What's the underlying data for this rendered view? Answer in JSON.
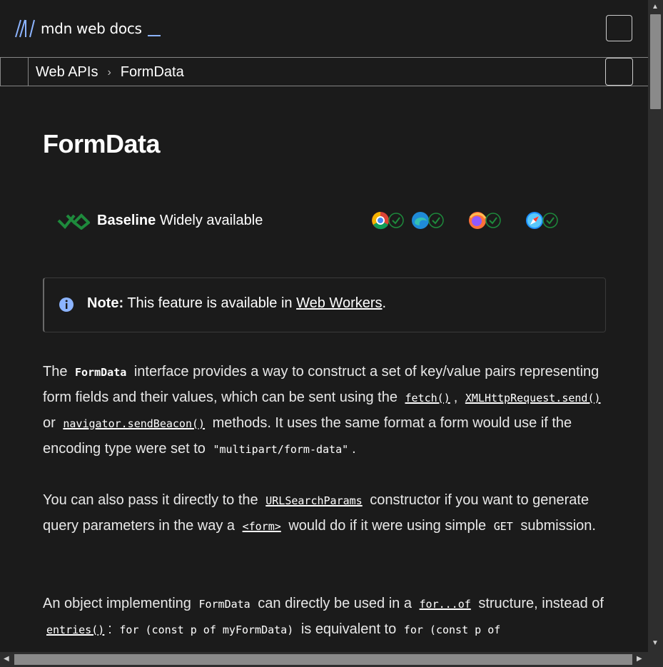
{
  "header": {
    "logo_text": "mdn web docs",
    "menu_button_label": ""
  },
  "breadcrumbs": [
    "Web APIs",
    "FormData"
  ],
  "breadcrumb_separator": "›",
  "page": {
    "title": "FormData"
  },
  "baseline": {
    "label": "Baseline",
    "status": "Widely available",
    "browsers": [
      {
        "name": "chrome-icon",
        "supported": true
      },
      {
        "name": "edge-icon",
        "supported": true
      },
      {
        "name": "firefox-icon",
        "supported": true
      },
      {
        "name": "safari-icon",
        "supported": true
      }
    ]
  },
  "note": {
    "label": "Note:",
    "text": "This feature is available in",
    "link": "Web Workers",
    "end": "."
  },
  "paragraphs": {
    "p1": {
      "t1": "The",
      "code1": "FormData",
      "t2": "interface provides a way to construct a set of key/value pairs representing form fields and their values, which can be sent using the",
      "link1": "fetch()",
      "t3": ",",
      "link2": "XMLHttpRequest.send()",
      "t4": "or",
      "link3": "navigator.sendBeacon()",
      "t5": "methods. It uses the same format a form would use if the encoding type were set to",
      "code2": "\"multipart/form-data\"",
      "t6": "."
    },
    "p2": {
      "t1": "You can also pass it directly to the",
      "link1": "URLSearchParams",
      "t2": "constructor if you want to generate query parameters in the way a",
      "link2": "<form>",
      "t3": "would do if it were using simple",
      "code1": "GET",
      "t4": "submission."
    },
    "p3": {
      "t1": "An object implementing",
      "code1": "FormData",
      "t2": "can directly be used in a",
      "link1": "for...of",
      "t3": "structure, instead of",
      "link2": "entries()",
      "t4": ":",
      "code2": "for (const p of myFormData)",
      "t5": "is equivalent to",
      "code3": "for (const p of"
    }
  },
  "colors": {
    "background": "#1b1b1b",
    "text": "#e8e8e8",
    "accent": "#8cb4ff",
    "baseline_green": "#1e8a3c"
  }
}
